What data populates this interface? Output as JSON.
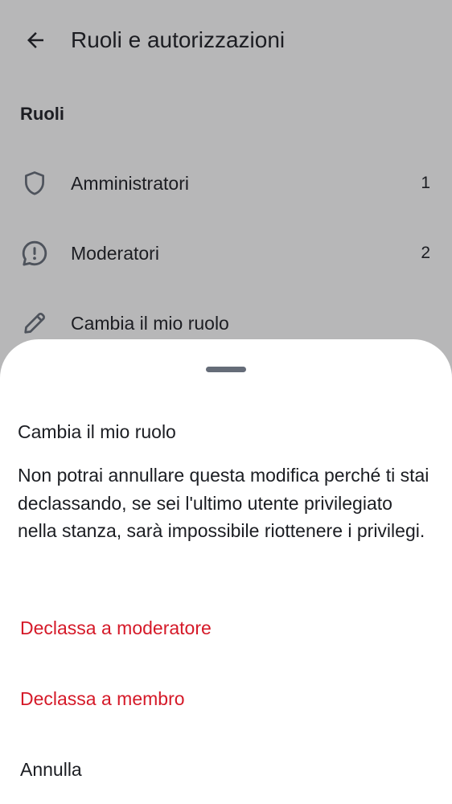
{
  "header": {
    "title": "Ruoli e autorizzazioni"
  },
  "roles_section": {
    "title": "Ruoli",
    "items": [
      {
        "label": "Amministratori",
        "count": "1",
        "icon": "shield-icon"
      },
      {
        "label": "Moderatori",
        "count": "2",
        "icon": "chat-alert-icon"
      },
      {
        "label": "Cambia il mio ruolo",
        "icon": "pencil-icon"
      }
    ]
  },
  "sheet": {
    "title": "Cambia il mio ruolo",
    "body": "Non potrai annullare questa modifica perché ti stai declassando, se sei l'ultimo utente privilegiato nella stanza, sarà impossibile riottenere i privilegi.",
    "actions": [
      {
        "label": "Declassa a moderatore",
        "style": "danger"
      },
      {
        "label": "Declassa a membro",
        "style": "danger"
      },
      {
        "label": "Annulla",
        "style": "neutral"
      }
    ]
  },
  "colors": {
    "danger": "#d51928",
    "text": "#1b1d22",
    "scrim": "rgba(30,31,35,0.32)"
  }
}
